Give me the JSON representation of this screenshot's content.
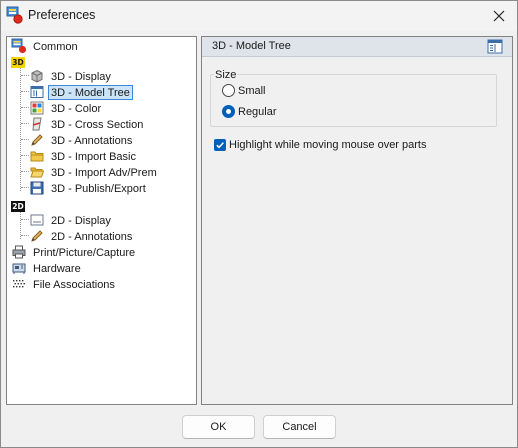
{
  "window": {
    "title": "Preferences"
  },
  "tree": {
    "common": "Common",
    "group_3d_badge": "3D",
    "items_3d": [
      {
        "label": "3D - Display",
        "icon": "cube-icon"
      },
      {
        "label": "3D - Model Tree",
        "icon": "model-tree-icon",
        "selected": true
      },
      {
        "label": "3D - Color",
        "icon": "color-palette-icon"
      },
      {
        "label": "3D - Cross Section",
        "icon": "cross-section-icon"
      },
      {
        "label": "3D - Annotations",
        "icon": "pencil-icon"
      },
      {
        "label": "3D - Import Basic",
        "icon": "folder-icon"
      },
      {
        "label": "3D - Import Adv/Prem",
        "icon": "folder-open-icon"
      },
      {
        "label": "3D - Publish/Export",
        "icon": "floppy-disk-icon"
      }
    ],
    "group_2d_badge": "2D",
    "items_2d": [
      {
        "label": "2D - Display",
        "icon": "display-icon"
      },
      {
        "label": "2D - Annotations",
        "icon": "pencil-icon"
      }
    ],
    "others": [
      {
        "label": "Print/Picture/Capture",
        "icon": "printer-icon"
      },
      {
        "label": "Hardware",
        "icon": "hardware-icon"
      },
      {
        "label": "File Associations",
        "icon": "file-associations-icon"
      }
    ]
  },
  "panel": {
    "title": "3D - Model Tree",
    "size_group_label": "Size",
    "size_options": [
      {
        "label": "Small",
        "checked": false
      },
      {
        "label": "Regular",
        "checked": true
      }
    ],
    "highlight_label": "Highlight while moving mouse over parts",
    "highlight_checked": true
  },
  "buttons": {
    "ok": "OK",
    "cancel": "Cancel"
  },
  "colors": {
    "accent": "#005fb8",
    "selection_bg": "#cce4f7",
    "badge_3d": "#f6d400",
    "badge_2d": "#111111"
  }
}
